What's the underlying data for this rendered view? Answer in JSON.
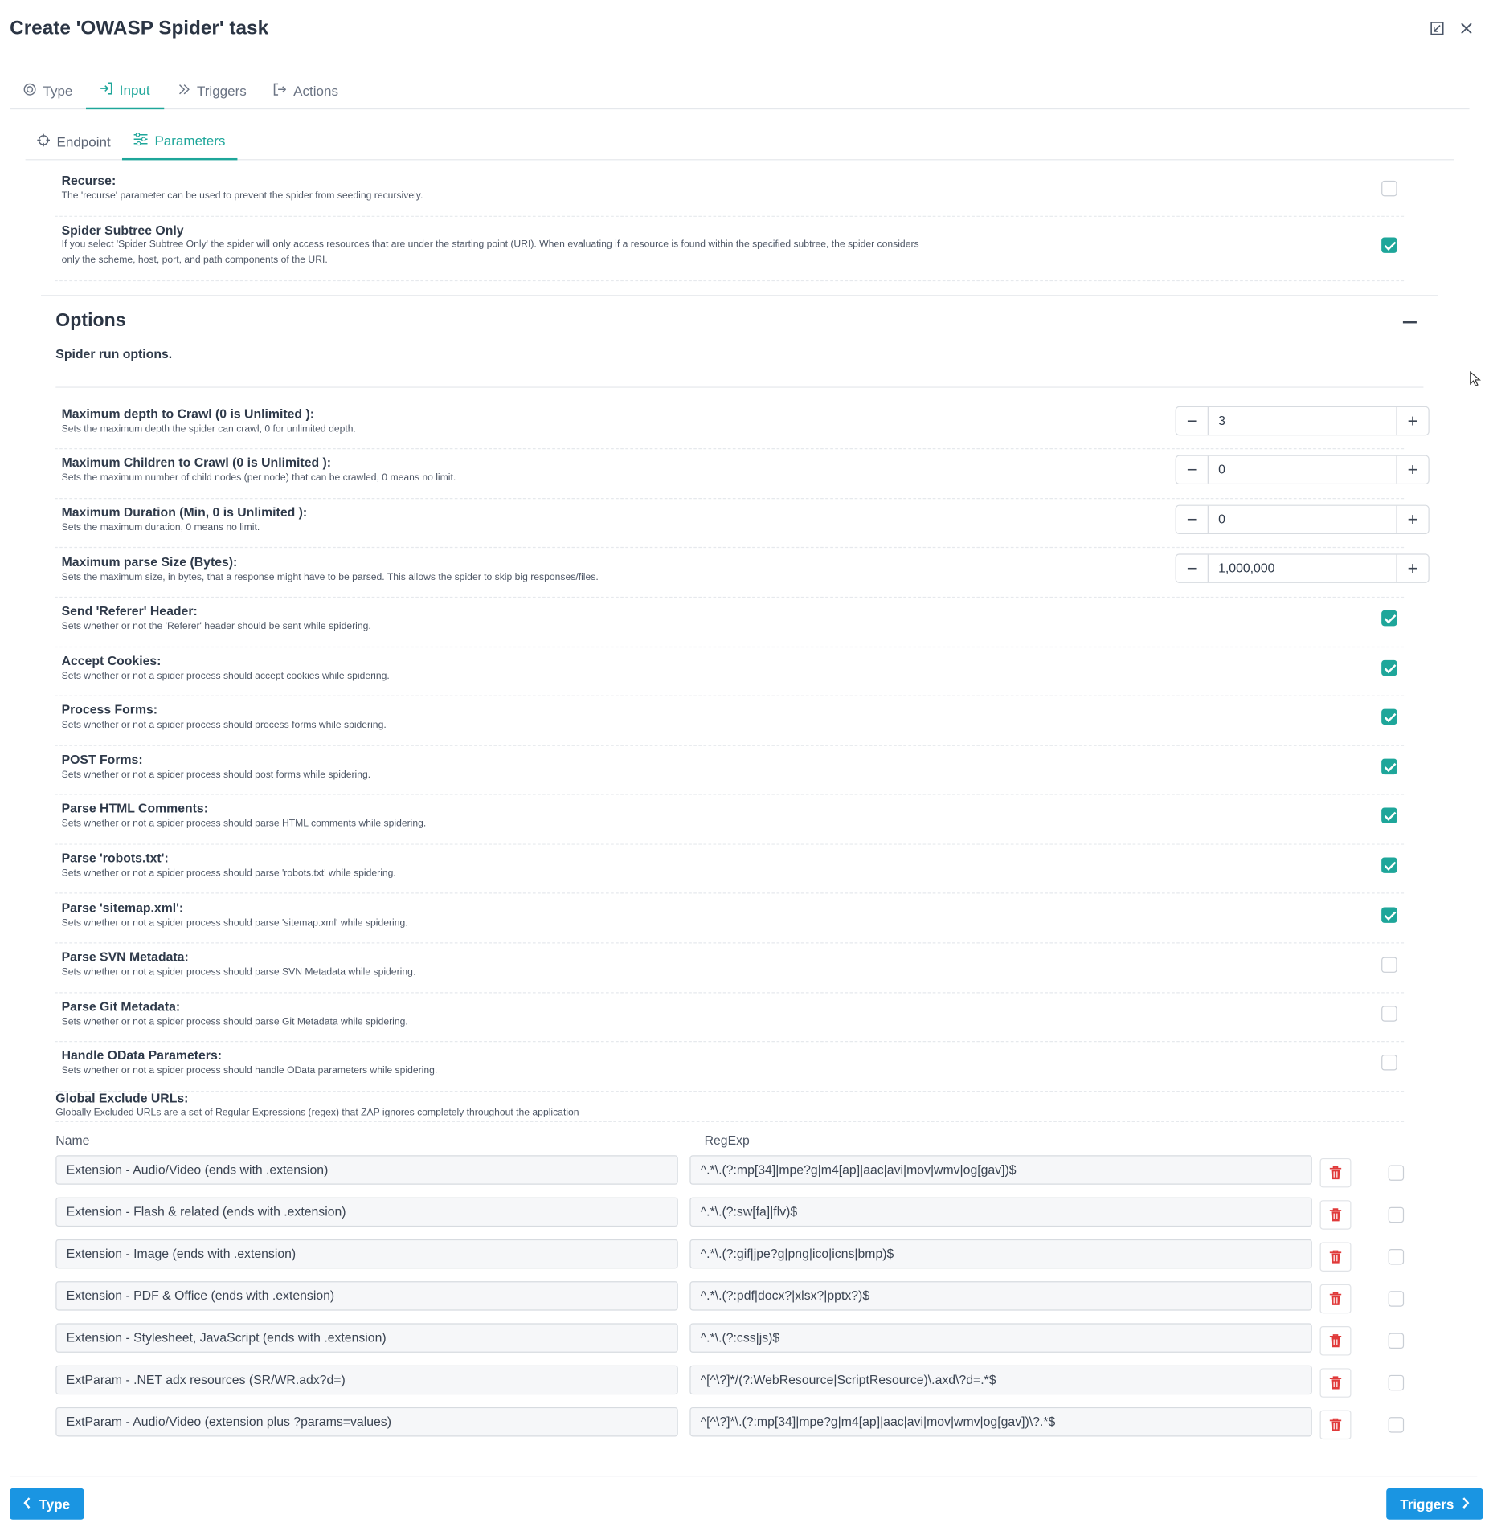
{
  "dialog": {
    "title": "Create 'OWASP Spider' task",
    "restore_icon": "restore-window-icon",
    "close_icon": "close-icon"
  },
  "tabs": [
    {
      "label": "Type",
      "icon": "target-icon",
      "active": false
    },
    {
      "label": "Input",
      "icon": "sign-in-icon",
      "active": true
    },
    {
      "label": "Triggers",
      "icon": "double-chevron-icon",
      "active": false
    },
    {
      "label": "Actions",
      "icon": "sign-out-icon",
      "active": false
    }
  ],
  "subtabs": [
    {
      "label": "Endpoint",
      "icon": "crosshair-icon",
      "active": false
    },
    {
      "label": "Parameters",
      "icon": "sliders-icon",
      "active": true
    }
  ],
  "top_params": [
    {
      "label": "Recurse:",
      "desc": "The 'recurse' parameter can be used to prevent the spider from seeding recursively.",
      "checked": false
    },
    {
      "label": "Spider Subtree Only",
      "desc": "If you select 'Spider Subtree Only' the spider will only access resources that are under the starting point (URI). When evaluating if a resource is found within the specified subtree, the spider considers",
      "desc2": "only the scheme, host, port, and path components of the URI.",
      "checked": true
    }
  ],
  "options": {
    "title": "Options",
    "subtitle": "Spider run options.",
    "numeric": [
      {
        "label": "Maximum depth to Crawl (0 is Unlimited ):",
        "desc": "Sets the maximum depth the spider can crawl, 0 for unlimited depth.",
        "value": "3"
      },
      {
        "label": "Maximum Children to Crawl (0 is Unlimited ):",
        "desc": "Sets the maximum number of child nodes (per node) that can be crawled, 0 means no limit.",
        "value": "0"
      },
      {
        "label": "Maximum Duration (Min, 0 is Unlimited ):",
        "desc": "Sets the maximum duration, 0 means no limit.",
        "value": "0"
      },
      {
        "label": "Maximum parse Size (Bytes):",
        "desc": "Sets the maximum size, in bytes, that a response might have to be parsed. This allows the spider to skip big responses/files.",
        "value": "1,000,000"
      }
    ],
    "toggles": [
      {
        "label": "Send 'Referer' Header:",
        "desc": "Sets whether or not the 'Referer' header should be sent while spidering.",
        "checked": true
      },
      {
        "label": "Accept Cookies:",
        "desc": "Sets whether or not a spider process should accept cookies while spidering.",
        "checked": true
      },
      {
        "label": "Process Forms:",
        "desc": "Sets whether or not a spider process should process forms while spidering.",
        "checked": true
      },
      {
        "label": "POST Forms:",
        "desc": "Sets whether or not a spider process should post forms while spidering.",
        "checked": true
      },
      {
        "label": "Parse HTML Comments:",
        "desc": "Sets whether or not a spider process should parse HTML comments while spidering.",
        "checked": true
      },
      {
        "label": "Parse 'robots.txt':",
        "desc": "Sets whether or not a spider process should parse 'robots.txt' while spidering.",
        "checked": true
      },
      {
        "label": "Parse 'sitemap.xml':",
        "desc": "Sets whether or not a spider process should parse 'sitemap.xml' while spidering.",
        "checked": true
      },
      {
        "label": "Parse SVN Metadata:",
        "desc": "Sets whether or not a spider process should parse SVN Metadata while spidering.",
        "checked": false
      },
      {
        "label": "Parse Git Metadata:",
        "desc": "Sets whether or not a spider process should parse Git Metadata while spidering.",
        "checked": false
      },
      {
        "label": "Handle OData Parameters:",
        "desc": "Sets whether or not a spider process should handle OData parameters while spidering.",
        "checked": false
      }
    ]
  },
  "global_exclude": {
    "title": "Global Exclude URLs:",
    "desc": "Globally Excluded URLs are a set of Regular Expressions (regex) that ZAP ignores completely throughout the application",
    "col_name": "Name",
    "col_regexp": "RegExp",
    "rows": [
      {
        "name": "Extension - Audio/Video (ends with .extension)",
        "regexp": "^.*\\.(?:mp[34]|mpe?g|m4[ap]|aac|avi|mov|wmv|og[gav])$",
        "checked": false
      },
      {
        "name": "Extension - Flash & related (ends with .extension)",
        "regexp": "^.*\\.(?:sw[fa]|flv)$",
        "checked": false
      },
      {
        "name": "Extension - Image (ends with .extension)",
        "regexp": "^.*\\.(?:gif|jpe?g|png|ico|icns|bmp)$",
        "checked": false
      },
      {
        "name": "Extension - PDF & Office (ends with .extension)",
        "regexp": "^.*\\.(?:pdf|docx?|xlsx?|pptx?)$",
        "checked": false
      },
      {
        "name": "Extension - Stylesheet, JavaScript (ends with .extension)",
        "regexp": "^.*\\.(?:css|js)$",
        "checked": false
      },
      {
        "name": "ExtParam - .NET adx resources (SR/WR.adx?d=)",
        "regexp": "^[^\\?]*/(?:WebResource|ScriptResource)\\.axd\\?d=.*$",
        "checked": false
      },
      {
        "name": "ExtParam - Audio/Video (extension plus ?params=values)",
        "regexp": "^[^\\?]*\\.(?:mp[34]|mpe?g|m4[ap]|aac|avi|mov|wmv|og[gav])\\?.*$",
        "checked": false
      }
    ]
  },
  "footer": {
    "back_label": "Type",
    "next_label": "Triggers"
  },
  "colors": {
    "accent": "#1ea69a",
    "primary_button": "#1a95e2",
    "delete": "#e03a3a"
  }
}
